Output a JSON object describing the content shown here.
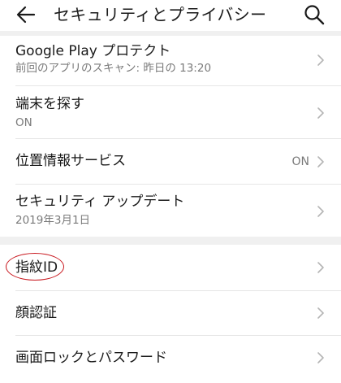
{
  "header": {
    "title": "セキュリティとプライバシー",
    "back_icon": "arrow-left-icon",
    "search_icon": "search-icon"
  },
  "items": [
    {
      "primary": "Google Play プロテクト",
      "secondary": "前回のアプリのスキャン: 昨日の 13:20"
    },
    {
      "primary": "端末を探す",
      "secondary": "ON"
    },
    {
      "primary": "位置情報サービス",
      "value": "ON"
    },
    {
      "primary": "セキュリティ アップデート",
      "secondary": "2019年3月1日"
    },
    {
      "primary": "指紋ID"
    },
    {
      "primary": "顔認証"
    },
    {
      "primary": "画面ロックとパスワード"
    }
  ],
  "colors": {
    "annotation_circle": "#c8161d",
    "secondary_text": "#7a7a7a",
    "section_gap": "#f0f0f0"
  }
}
